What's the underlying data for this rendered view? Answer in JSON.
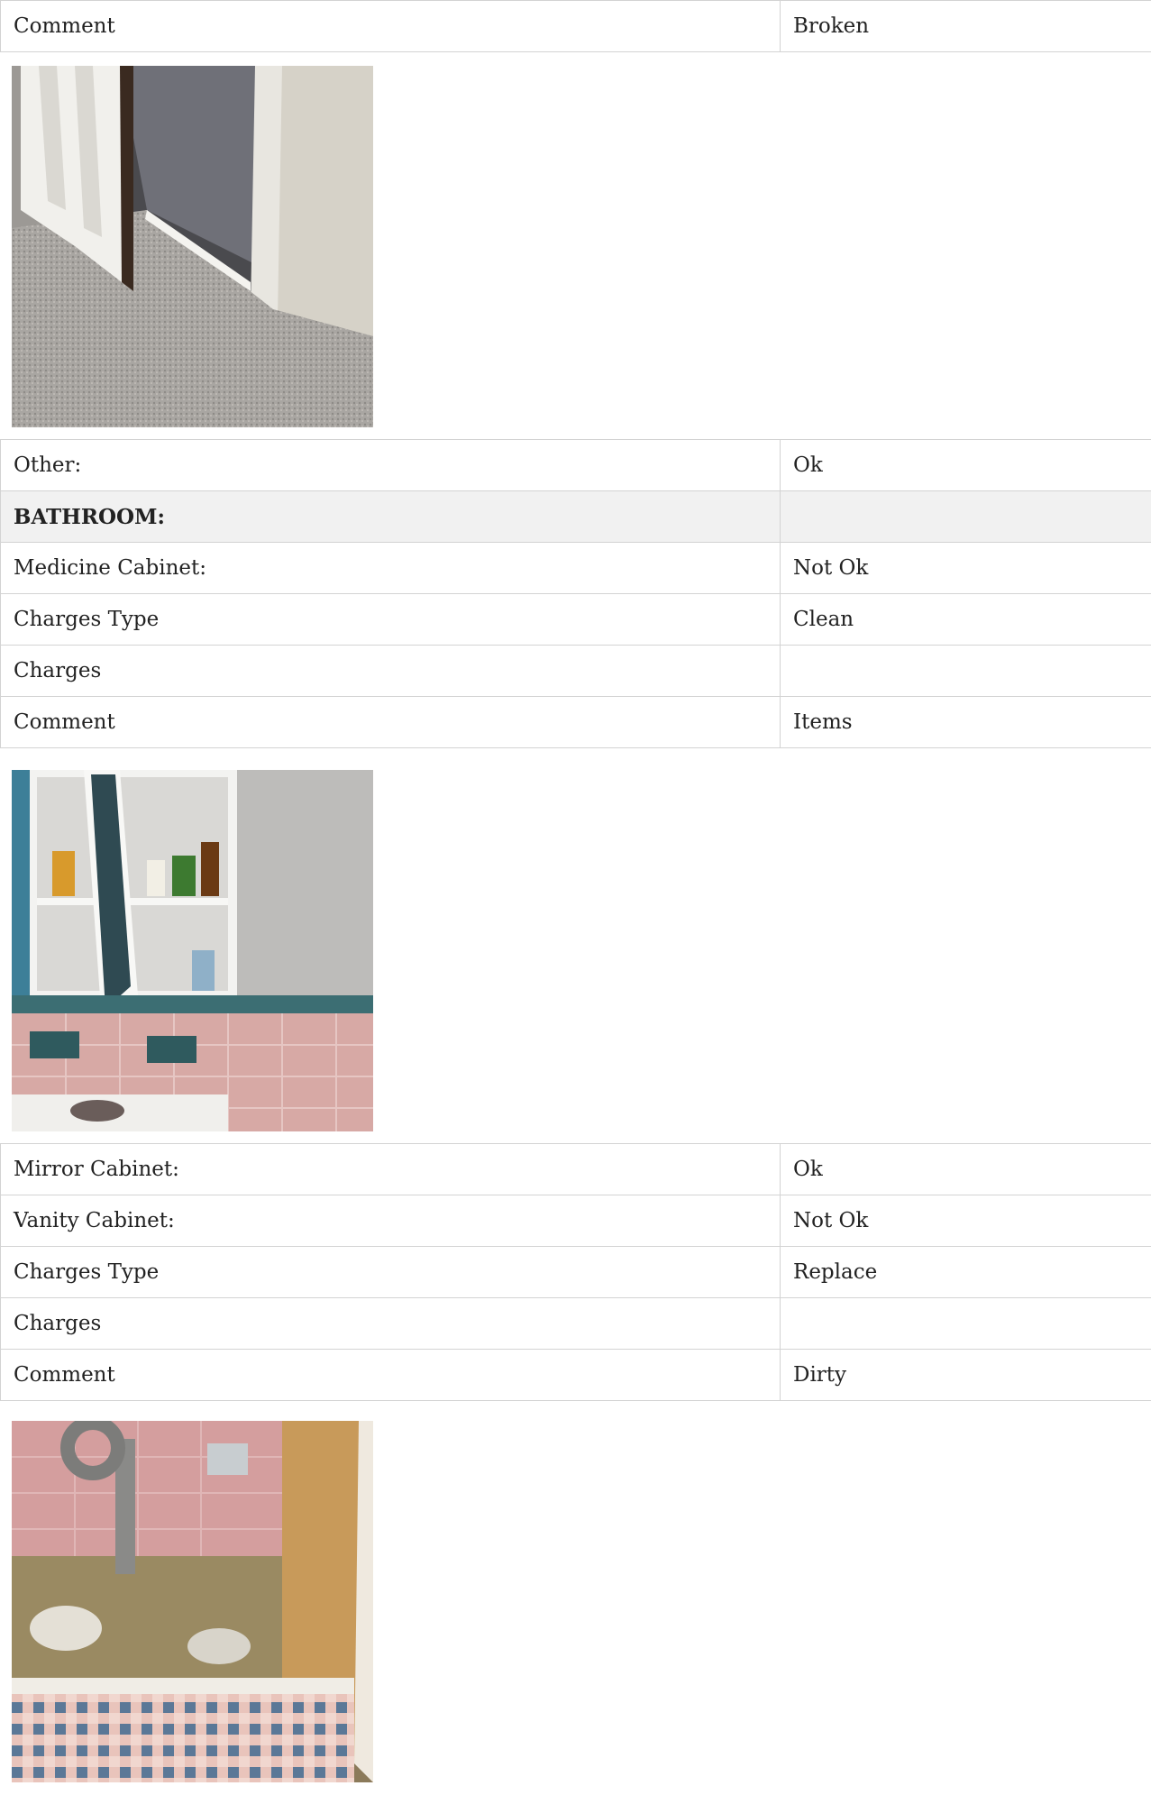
{
  "sections": [
    {
      "rows": [
        {
          "label": "Comment",
          "value": "Broken"
        }
      ],
      "photo": "door-photo"
    },
    {
      "rows": [
        {
          "label": "Other:",
          "value": "Ok"
        },
        {
          "label": "BATHROOM:",
          "value": "",
          "heading": true
        },
        {
          "label": "Medicine Cabinet:",
          "value": "Not Ok"
        },
        {
          "label": "Charges Type",
          "value": "Clean"
        },
        {
          "label": "Charges",
          "value": ""
        },
        {
          "label": "Comment",
          "value": "Items"
        }
      ],
      "photo": "medicine-cabinet-photo"
    },
    {
      "rows": [
        {
          "label": "Mirror Cabinet:",
          "value": "Ok"
        },
        {
          "label": "Vanity Cabinet:",
          "value": "Not Ok"
        },
        {
          "label": "Charges Type",
          "value": "Replace"
        },
        {
          "label": "Charges",
          "value": ""
        },
        {
          "label": "Comment",
          "value": "Dirty"
        }
      ],
      "photo": "vanity-cabinet-photo"
    }
  ]
}
